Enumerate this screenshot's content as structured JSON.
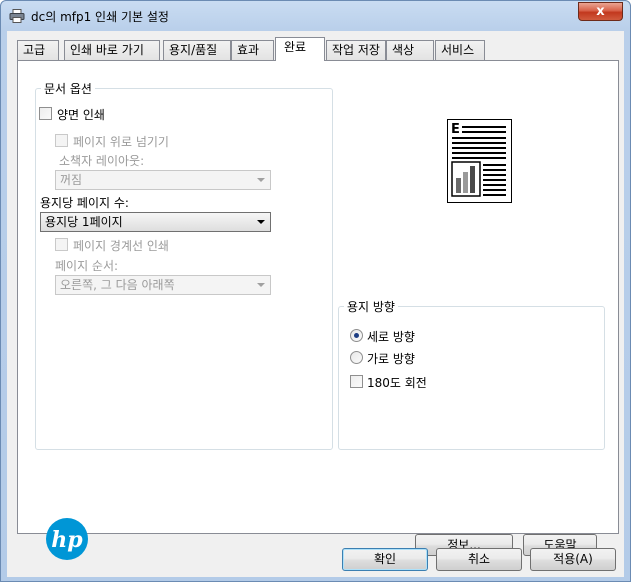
{
  "window": {
    "title": "dc의 mfp1 인쇄 기본 설정",
    "close_label": "x"
  },
  "tabs": [
    {
      "label": "고급"
    },
    {
      "label": "인쇄 바로 가기"
    },
    {
      "label": "용지/품질"
    },
    {
      "label": "효과"
    },
    {
      "label": "완료",
      "active": true
    },
    {
      "label": "작업 저장"
    },
    {
      "label": "색상"
    },
    {
      "label": "서비스"
    }
  ],
  "document_options": {
    "title": "문서 옵션",
    "duplex_label": "양면 인쇄",
    "flip_pages_up_label": "페이지 위로 넘기기",
    "booklet_layout_label": "소책자 레이아웃:",
    "booklet_layout_value": "꺼짐",
    "pages_per_sheet_label": "용지당 페이지 수:",
    "pages_per_sheet_value": "용지당 1페이지",
    "print_page_borders_label": "페이지 경계선 인쇄",
    "page_order_label": "페이지 순서:",
    "page_order_value": "오른쪽, 그 다음 아래쪽"
  },
  "orientation": {
    "title": "용지 방향",
    "portrait_label": "세로 방향",
    "landscape_label": "가로 방향",
    "rotate_label": "180도 회전",
    "selected": "portrait"
  },
  "buttons": {
    "about": "정보...",
    "help": "도움말",
    "ok": "확인",
    "cancel": "취소",
    "apply": "적용(A)"
  },
  "logo": {
    "text": "hp"
  },
  "colors": {
    "titlebar": "#b9cfea",
    "hp_blue": "#0096d6",
    "close_red": "#c2381e"
  }
}
